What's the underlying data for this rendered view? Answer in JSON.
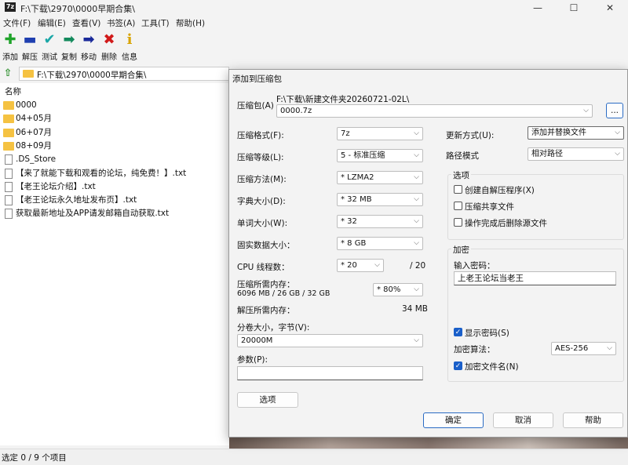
{
  "main": {
    "title": "F:\\下载\\2970\\0000早期合集\\",
    "app_icon_text": "7z",
    "window_controls": {
      "minimize": "—",
      "maximize": "☐",
      "close": "✕"
    },
    "menu": [
      "文件(F)",
      "编辑(E)",
      "查看(V)",
      "书签(A)",
      "工具(T)",
      "帮助(H)"
    ],
    "toolbar": [
      {
        "label": "添加",
        "icon": "plus-icon",
        "glyph": "✚",
        "color": "#1fa32a"
      },
      {
        "label": "解压",
        "icon": "minus-icon",
        "glyph": "▬",
        "color": "#1f3fb0"
      },
      {
        "label": "测试",
        "icon": "check-icon",
        "glyph": "✔",
        "color": "#1aa7a7"
      },
      {
        "label": "复制",
        "icon": "copy-arrow-icon",
        "glyph": "➡",
        "color": "#138a5c"
      },
      {
        "label": "移动",
        "icon": "move-arrow-icon",
        "glyph": "➡",
        "color": "#1a2a9a"
      },
      {
        "label": "删除",
        "icon": "delete-x-icon",
        "glyph": "✖",
        "color": "#d11a1a"
      },
      {
        "label": "信息",
        "icon": "info-icon",
        "glyph": "i",
        "color": "#d8a300"
      }
    ],
    "address": "F:\\下载\\2970\\0000早期合集\\",
    "list_header": "名称",
    "files": [
      {
        "name": "0000",
        "type": "folder"
      },
      {
        "name": "04+05月",
        "type": "folder"
      },
      {
        "name": "06+07月",
        "type": "folder"
      },
      {
        "name": "08+09月",
        "type": "folder"
      },
      {
        "name": ".DS_Store",
        "type": "file"
      },
      {
        "name": "【来了就能下载和观看的论坛，纯免费！】.txt",
        "type": "file"
      },
      {
        "name": "【老王论坛介绍】.txt",
        "type": "file"
      },
      {
        "name": "【老王论坛永久地址发布页】.txt",
        "type": "file"
      },
      {
        "name": "获取最新地址及APP请发邮箱自动获取.txt",
        "type": "file"
      }
    ],
    "status": "选定 0 / 9 个项目"
  },
  "dialog": {
    "title": "添加到压缩包",
    "archive_label": "压缩包(A)",
    "archive_path": "F:\\下载\\新建文件夹20260721-02L\\",
    "archive_name": "0000.7z",
    "browse_label": "...",
    "format_label": "压缩格式(F):",
    "format_value": "7z",
    "level_label": "压缩等级(L):",
    "level_value": "5 - 标准压缩",
    "method_label": "压缩方法(M):",
    "method_value": "* LZMA2",
    "dict_label": "字典大小(D):",
    "dict_value": "* 32 MB",
    "word_label": "单词大小(W):",
    "word_value": "* 32",
    "solid_label": "固实数据大小：",
    "solid_value": "* 8 GB",
    "threads_label": "CPU 线程数：",
    "threads_value": "* 20",
    "threads_max": "/ 20",
    "mem_compress_label": "压缩所需内存：",
    "mem_compress_detail": "6096 MB / 26 GB / 32 GB",
    "mem_percent": "* 80%",
    "mem_decompress_label": "解压所需内存：",
    "mem_decompress_value": "34 MB",
    "volume_label": "分卷大小，字节(V):",
    "volume_value": "20000M",
    "params_label": "参数(P):",
    "params_value": "",
    "options_button": "选项",
    "update_label": "更新方式(U):",
    "update_value": "添加并替换文件",
    "path_label": "路径模式",
    "path_value": "相对路径",
    "options_group": "选项",
    "opt_sfx": "创建自解压程序(X)",
    "opt_shared": "压缩共享文件",
    "opt_delete": "操作完成后删除源文件",
    "encrypt_group": "加密",
    "password_label": "输入密码：",
    "password_value": "上老王论坛当老王",
    "show_password": "显示密码(S)",
    "enc_method_label": "加密算法：",
    "enc_method_value": "AES-256",
    "encrypt_names": "加密文件名(N)",
    "ok": "确定",
    "cancel": "取消",
    "help": "帮助"
  }
}
